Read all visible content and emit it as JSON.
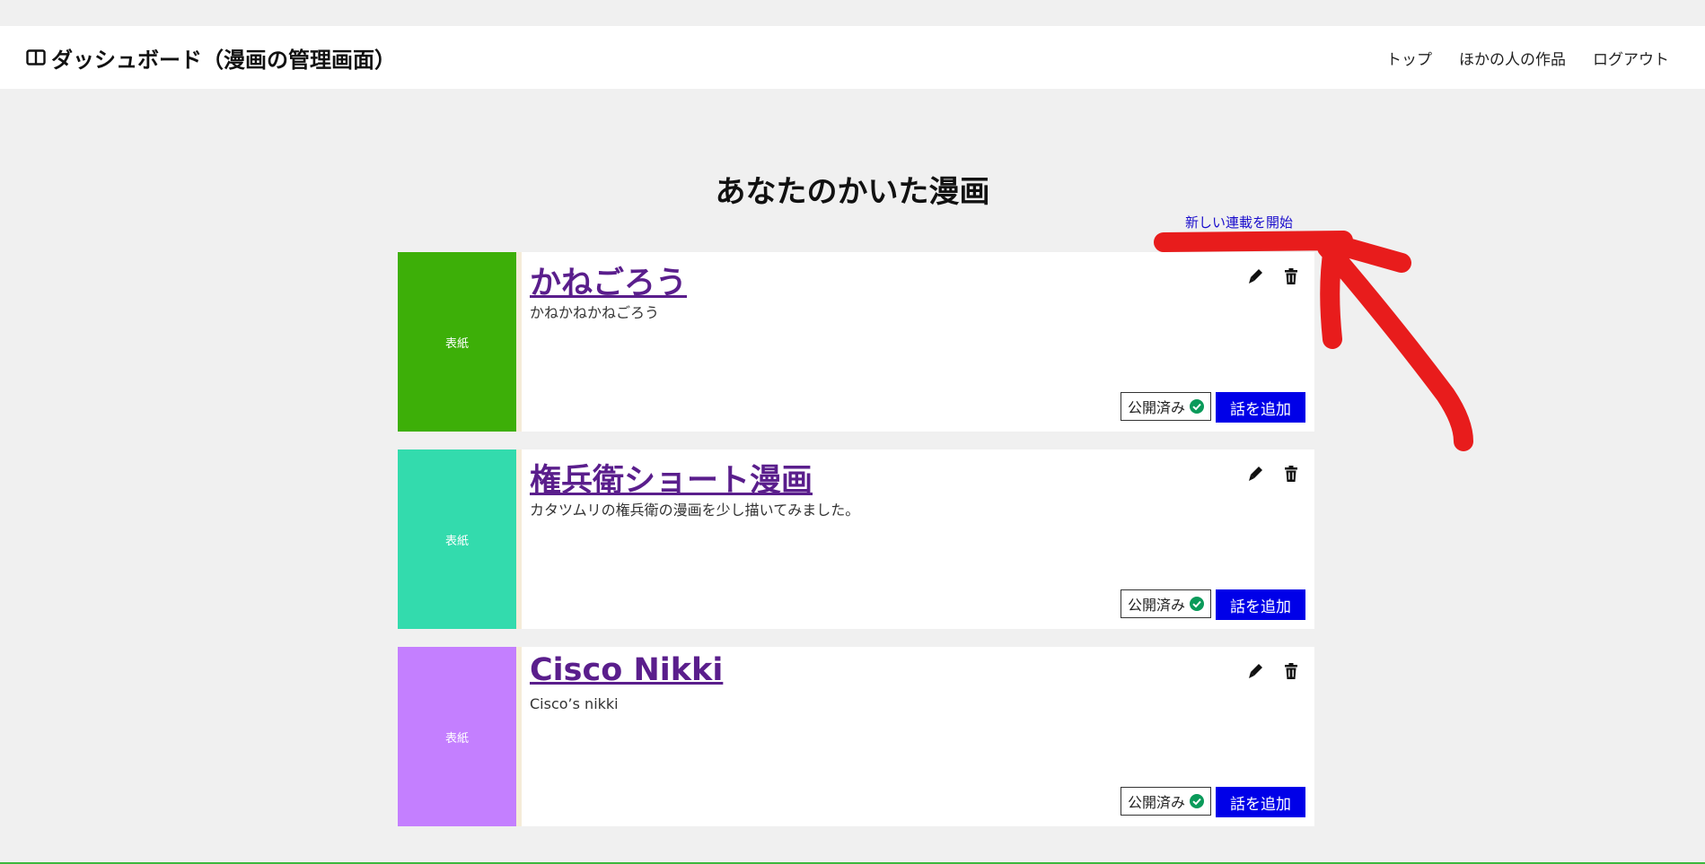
{
  "navbar": {
    "brand_icon": "book-open-icon",
    "brand_title": "ダッシュボード（漫画の管理画面）",
    "links": [
      "トップ",
      "ほかの人の作品",
      "ログアウト"
    ]
  },
  "page_title": "あなたのかいた漫画",
  "new_series_link": "新しい連載を開始",
  "cards": [
    {
      "cover_label": "表紙",
      "cover_color": "#3daf08",
      "title": "かねごろう",
      "description": "かねかねかねごろう",
      "status": "公開済み",
      "add_button": "話を追加"
    },
    {
      "cover_label": "表紙",
      "cover_color": "#33dbad",
      "title": "権兵衛ショート漫画",
      "description": "カタツムリの権兵衛の漫画を少し描いてみました。",
      "status": "公開済み",
      "add_button": "話を追加"
    },
    {
      "cover_label": "表紙",
      "cover_color": "#c47fff",
      "title": "Cisco Nikki",
      "description": "Cisco’s nikki",
      "status": "公開済み",
      "add_button": "話を追加"
    }
  ],
  "icons": {
    "edit": "pen-icon",
    "delete": "trash-icon",
    "status": "check-circle-icon"
  },
  "colors": {
    "add_button": "#0000e8",
    "title_link": "#5a1e8c",
    "check": "#0a9a5a",
    "annotation_arrow": "#e81c1c"
  }
}
